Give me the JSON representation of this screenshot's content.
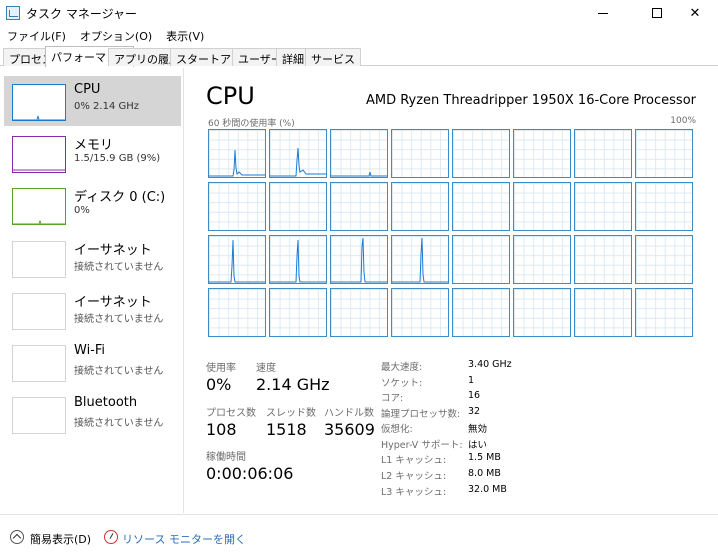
{
  "window": {
    "title": "タスク マネージャー",
    "buttons": {
      "minimize": "─",
      "maximize": "☐",
      "close": "✕"
    }
  },
  "menu": [
    "ファイル(F)",
    "オプション(O)",
    "表示(V)"
  ],
  "tabs": [
    {
      "label": "プロセス",
      "active": false
    },
    {
      "label": "パフォーマンス",
      "active": true
    },
    {
      "label": "アプリの履歴",
      "active": false
    },
    {
      "label": "スタートアップ",
      "active": false
    },
    {
      "label": "ユーザー",
      "active": false
    },
    {
      "label": "詳細",
      "active": false
    },
    {
      "label": "サービス",
      "active": false
    }
  ],
  "sidebar": {
    "items": [
      {
        "name": "CPU",
        "sub": "0% 2.14 GHz",
        "color": "#1a7ad4",
        "selected": true
      },
      {
        "name": "メモリ",
        "sub": "1.5/15.9 GB (9%)",
        "color": "#8b2aa8",
        "selected": false
      },
      {
        "name": "ディスク 0 (C:)",
        "sub": "0%",
        "color": "#5aa02c",
        "selected": false
      },
      {
        "name": "イーサネット",
        "sub": "接続されていません",
        "color": "#d4d4d4",
        "selected": false
      },
      {
        "name": "イーサネット",
        "sub": "接続されていません",
        "color": "#d4d4d4",
        "selected": false
      },
      {
        "name": "Wi-Fi",
        "sub": "接続されていません",
        "color": "#d4d4d4",
        "selected": false
      },
      {
        "name": "Bluetooth",
        "sub": "接続されていません",
        "color": "#d4d4d4",
        "selected": false
      }
    ]
  },
  "main": {
    "title": "CPU",
    "processor": "AMD Ryzen Threadripper 1950X 16-Core Processor",
    "graph_label": "60 秒間の使用率 (%)",
    "graph_max": "100%",
    "logical_processor_count": 32,
    "stats": {
      "utilization_label": "使用率",
      "utilization": "0%",
      "speed_label": "速度",
      "speed": "2.14 GHz",
      "processes_label": "プロセス数",
      "processes": "108",
      "threads_label": "スレッド数",
      "threads": "1518",
      "handles_label": "ハンドル数",
      "handles": "35609",
      "uptime_label": "稼働時間",
      "uptime": "0:00:06:06"
    },
    "specs": [
      {
        "key": "最大速度:",
        "value": "3.40 GHz"
      },
      {
        "key": "ソケット:",
        "value": "1"
      },
      {
        "key": "コア:",
        "value": "16"
      },
      {
        "key": "論理プロセッサ数:",
        "value": "32"
      },
      {
        "key": "仮想化:",
        "value": "無効"
      },
      {
        "key": "Hyper-V サポート:",
        "value": "はい"
      },
      {
        "key": "L1 キャッシュ:",
        "value": "1.5 MB"
      },
      {
        "key": "L2 キャッシュ:",
        "value": "8.0 MB"
      },
      {
        "key": "L3 キャッシュ:",
        "value": "32.0 MB"
      }
    ]
  },
  "footer": {
    "fewer_details": "簡易表示(D)",
    "resource_monitor": "リソース モニターを開く"
  }
}
